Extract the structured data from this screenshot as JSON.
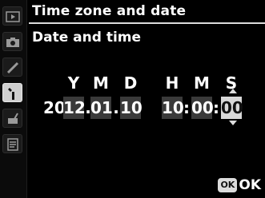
{
  "header": {
    "title": "Time zone and date",
    "subtitle": "Date and time"
  },
  "fields": {
    "Y": "Y",
    "M": "M",
    "D": "D",
    "H": "H",
    "Min": "M",
    "S": "S"
  },
  "values": {
    "year_prefix": "20",
    "year": "12",
    "month": "01",
    "day": "10",
    "hour": "10",
    "minute": "00",
    "second": "00"
  },
  "separators": {
    "date": ".",
    "time": ":"
  },
  "footer": {
    "ok_icon": "OK",
    "ok_text": "OK"
  },
  "rail": {
    "icons": [
      "playback-icon",
      "camera-icon",
      "pencil-icon",
      "wrench-icon",
      "retouch-brush-icon",
      "recent-settings-icon"
    ]
  },
  "colors": {
    "selected_field_bg": "#d8d8d8",
    "field_bg": "#3a3a3a",
    "accent": "#dcdcdc"
  }
}
